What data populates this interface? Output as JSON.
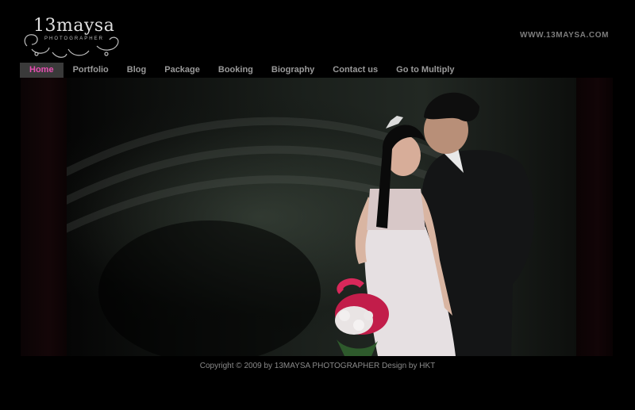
{
  "logo": {
    "text": "13maysa",
    "tagline": "PHOTOGRAPHER"
  },
  "header": {
    "site_url": "WWW.13MAYSA.COM"
  },
  "nav": {
    "items": [
      {
        "label": "Home",
        "active": true
      },
      {
        "label": "Portfolio"
      },
      {
        "label": "Blog"
      },
      {
        "label": "Package"
      },
      {
        "label": "Booking"
      },
      {
        "label": "Biography"
      },
      {
        "label": "Contact us"
      },
      {
        "label": "Go to Multiply"
      }
    ]
  },
  "hero": {
    "subject": "wedding-couple-photo"
  },
  "footer": {
    "copyright": "Copyright © 2009 by 13MAYSA PHOTOGRAPHER Design by HKT"
  },
  "colors": {
    "background": "#000000",
    "accent": "#e84fb3",
    "nav_text": "#9a9a9a",
    "nav_active_bg": "#3a3a3a"
  }
}
